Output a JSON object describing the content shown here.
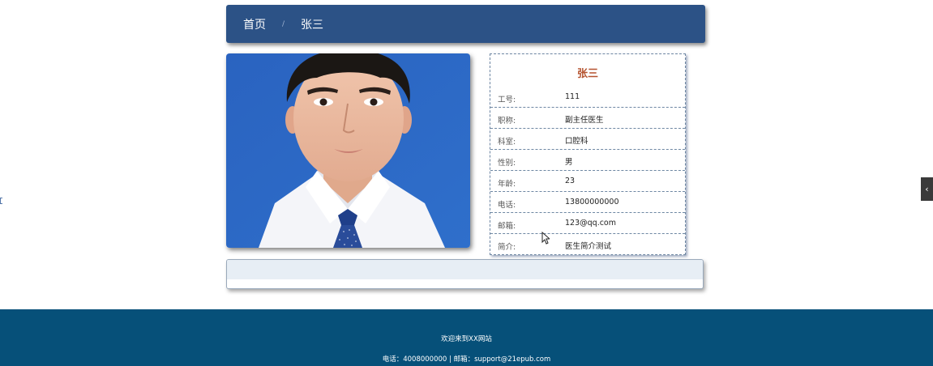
{
  "breadcrumb": {
    "home": "首页",
    "separator": "/",
    "current": "张三"
  },
  "doctor": {
    "name": "张三",
    "fields": [
      {
        "label": "工号:",
        "value": "111"
      },
      {
        "label": "职称:",
        "value": "副主任医生"
      },
      {
        "label": "科室:",
        "value": "口腔科"
      },
      {
        "label": "性别:",
        "value": "男"
      },
      {
        "label": "年龄:",
        "value": "23"
      },
      {
        "label": "电话:",
        "value": "13800000000"
      },
      {
        "label": "邮箱:",
        "value": "123@qq.com"
      },
      {
        "label": "简介:",
        "value": "医生简介测试"
      }
    ]
  },
  "side_toggle": {
    "icon": "chevron-left-icon",
    "glyph": "‹"
  },
  "footer": {
    "welcome": "欢迎来到XX网站",
    "contact": "电话：4008000000 | 邮箱：support@21epub.com"
  },
  "colors": {
    "header_bg": "#2c5286",
    "name_accent": "#b5532f",
    "footer_bg": "#065079"
  }
}
